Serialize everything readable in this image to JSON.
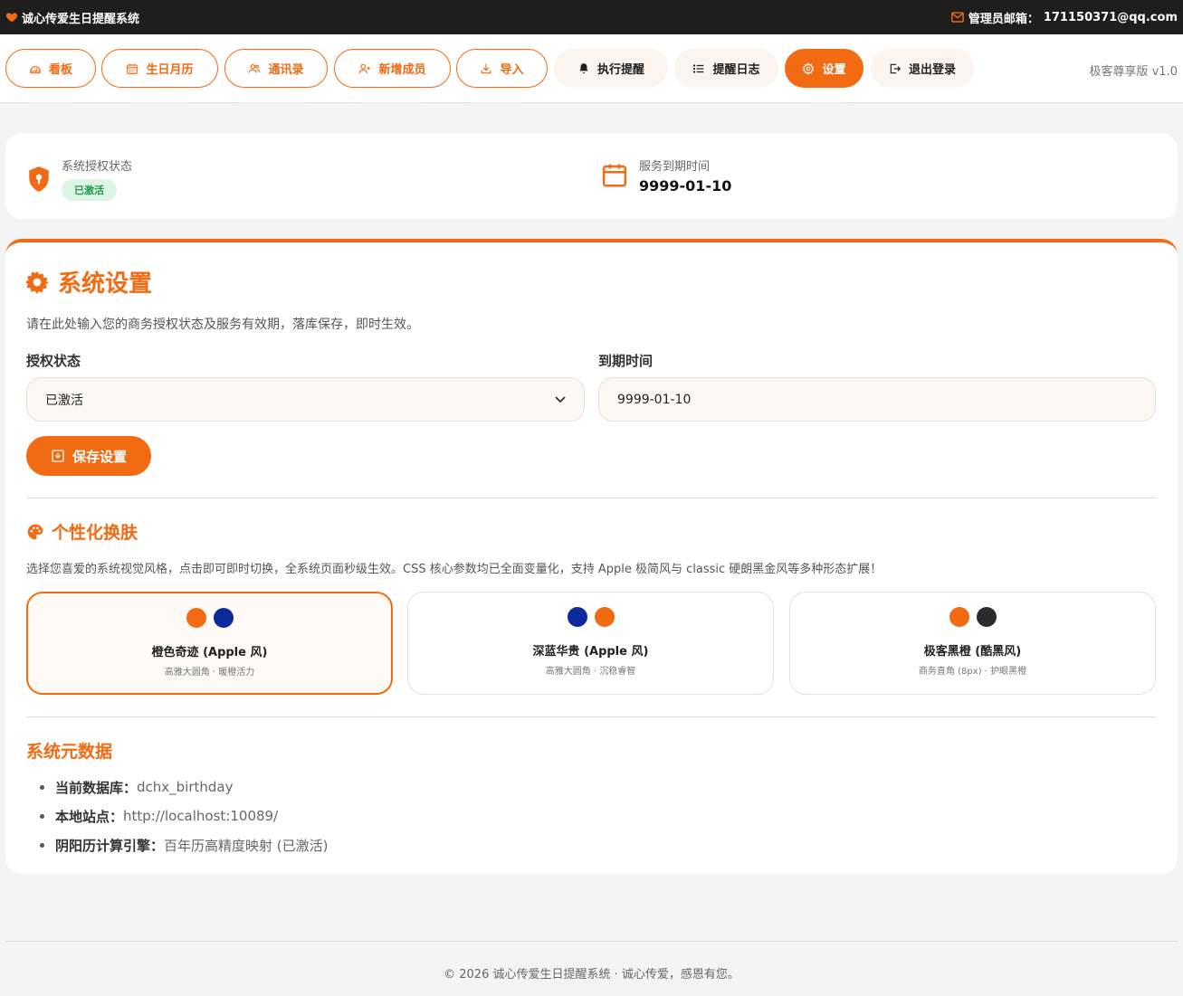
{
  "colors": {
    "accent": "#f26a11",
    "navy": "#0d2a9c",
    "black": "#2b2b2b",
    "success": "#1e9a4c"
  },
  "topbar": {
    "brand_icon": "heart-icon",
    "brand": "诚心传爱生日提醒系统",
    "mail_icon": "mail-icon",
    "mail_label": "管理员邮箱：",
    "mail_value": "171150371@qq.com"
  },
  "nav": {
    "items": [
      {
        "label": "看板",
        "icon": "dashboard-icon"
      },
      {
        "label": "生日月历",
        "icon": "calendar-icon"
      },
      {
        "label": "通讯录",
        "icon": "contacts-icon"
      },
      {
        "label": "新增成员",
        "icon": "add-user-icon"
      },
      {
        "label": "导入",
        "icon": "import-icon"
      },
      {
        "label": "执行提醒",
        "icon": "bell-icon"
      },
      {
        "label": "提醒日志",
        "icon": "list-icon"
      },
      {
        "label": "设置",
        "icon": "gear-icon"
      },
      {
        "label": "退出登录",
        "icon": "logout-icon"
      }
    ],
    "active": "设置",
    "version": "极客尊享版 v1.0"
  },
  "status": {
    "auth_label": "系统授权状态",
    "auth_badge": "已激活",
    "expire_label": "服务到期时间",
    "expire_value": "9999-01-10"
  },
  "settings": {
    "title": "系统设置",
    "description": "请在此处输入您的商务授权状态及服务有效期，落库保存，即时生效。",
    "auth_field_label": "授权状态",
    "auth_field_value": "已激活",
    "expire_field_label": "到期时间",
    "expire_field_value": "9999-01-10",
    "save_label": "保存设置"
  },
  "themes": {
    "title": "个性化换肤",
    "description": "选择您喜爱的系统视觉风格，点击即可即时切换，全系统页面秒级生效。CSS 核心参数均已全面变量化，支持 Apple 极简风与 classic 硬朗黑金风等多种形态扩展！",
    "items": [
      {
        "name": "橙色奇迹 (Apple 风)",
        "sub": "高雅大圆角 · 暖橙活力",
        "colors": [
          "#f26a11",
          "#0d2a9c"
        ],
        "selected": true
      },
      {
        "name": "深蓝华贵 (Apple 风)",
        "sub": "高雅大圆角 · 沉稳睿智",
        "colors": [
          "#0d2a9c",
          "#f26a11"
        ],
        "selected": false
      },
      {
        "name": "极客黑橙 (酷黑风)",
        "sub": "商务直角 (8px) · 护眼黑橙",
        "colors": [
          "#f26a11",
          "#2b2b2b"
        ],
        "selected": false
      }
    ]
  },
  "meta": {
    "title": "系统元数据",
    "items": [
      {
        "label": "当前数据库：",
        "value": "dchx_birthday"
      },
      {
        "label": "本地站点：",
        "value": "http://localhost:10089/"
      },
      {
        "label": "阴阳历计算引擎：",
        "value": "百年历高精度映射 (已激活)"
      }
    ]
  },
  "footer": {
    "text": "© 2026 诚心传爱生日提醒系统 · 诚心传爱，感恩有您。"
  }
}
